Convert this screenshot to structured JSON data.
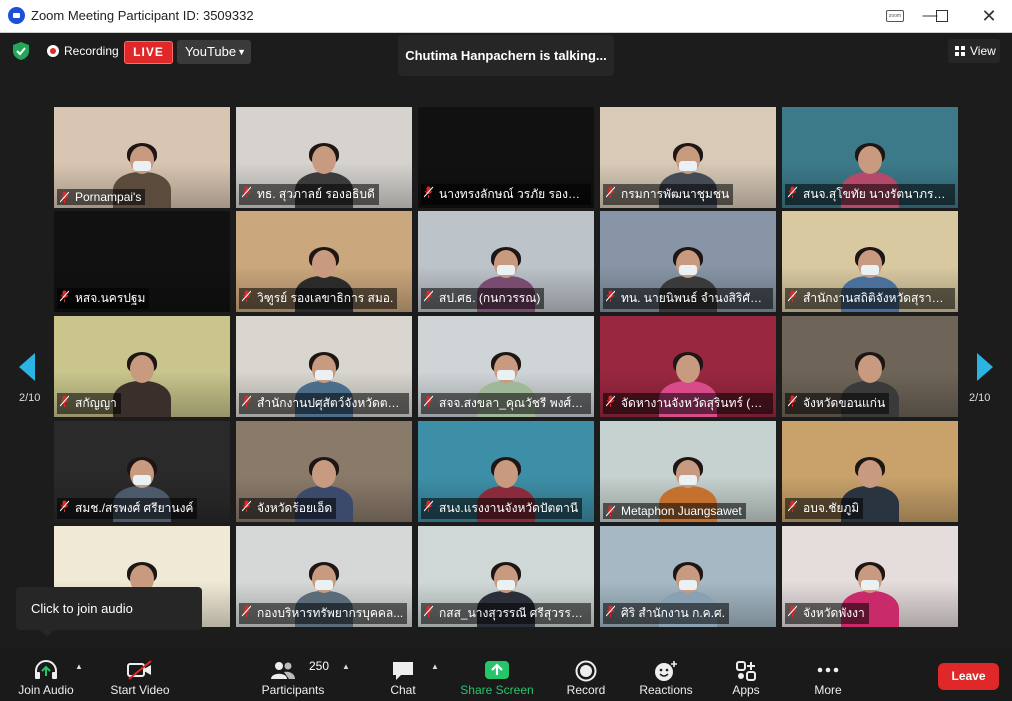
{
  "window": {
    "title": "Zoom Meeting Participant ID: 3509332",
    "controls": [
      "minimize",
      "maximize",
      "close"
    ]
  },
  "topbar": {
    "recording_label": "Recording",
    "live_label": "LIVE",
    "stream_target": "YouTube",
    "talking_banner": "Chutima Hanpachern is talking...",
    "view_label": "View"
  },
  "gallery": {
    "page_indicator": "2/10",
    "tiles": [
      {
        "name": "Pornampai's",
        "bg": "#d9c6b2",
        "body": "#5a4b3c",
        "mask": true
      },
      {
        "name": "ทธ. สุวภาลย์ รองอธิบดี",
        "bg": "#d6d3cf",
        "body": "#3b3b3b",
        "mask": false
      },
      {
        "name": "นางทรงลักษณ์ วรภัย รองผู้ว่า...",
        "bg": "#111111",
        "body": "#111111",
        "mask": false
      },
      {
        "name": "กรมการพัฒนาชุมชน",
        "bg": "#d8cab7",
        "body": "#444b55",
        "mask": true
      },
      {
        "name": "สนจ.สุโขทัย นางรัตนาภรณ์ ...",
        "bg": "#3c7a8a",
        "body": "#b34a6a",
        "mask": false
      },
      {
        "name": "หสจ.นครปฐม",
        "bg": "#111111",
        "body": "#111111",
        "mask": false
      },
      {
        "name": "วิฑูรย์ รองเลขาธิการ สมอ.",
        "bg": "#caa77c",
        "body": "#2a2a2a",
        "mask": false
      },
      {
        "name": "สป.ศธ. (กนกวรรณ)",
        "bg": "#bcc3c9",
        "body": "#7a4b70",
        "mask": true
      },
      {
        "name": "ทน. นายนิพนธ์ จำนงสิริศักดิ์...",
        "bg": "#8795a6",
        "body": "#3a3a3a",
        "mask": true
      },
      {
        "name": "สำนักงานสถิติจังหวัดสุราษฎร์...",
        "bg": "#d8c9a1",
        "body": "#4a6f9a",
        "mask": true
      },
      {
        "name": "สกัญญา",
        "bg": "#c9c58d",
        "body": "#3a2f2a",
        "mask": false
      },
      {
        "name": "สำนักงานปศุสัตว์จังหวัดตราด",
        "bg": "#d9d6cf",
        "body": "#4b6d8c",
        "mask": true
      },
      {
        "name": "สจจ.สงขลา_คุณวัชรี พงศ์นุรั...",
        "bg": "#cfd4d6",
        "body": "#9fb89a",
        "mask": true
      },
      {
        "name": "จัดหางานจังหวัดสุรินทร์ (ขนิ...",
        "bg": "#9a2740",
        "body": "#d84a8a",
        "mask": false
      },
      {
        "name": "จังหวัดขอนแก่น",
        "bg": "#6e6558",
        "body": "#3a3a3a",
        "mask": false
      },
      {
        "name": "สมช./สรพงศ์ ศรียานงค์",
        "bg": "#2a2a2a",
        "body": "#4a5a6a",
        "mask": true
      },
      {
        "name": "จังหวัดร้อยเอ็ด",
        "bg": "#8a7a6a",
        "body": "#3b4a6a",
        "mask": false
      },
      {
        "name": "สนง.แรงงานจังหวัดปัตตานี",
        "bg": "#3d8fa8",
        "body": "#8b2a3a",
        "mask": false
      },
      {
        "name": "Metaphon Juangsawet",
        "bg": "#c6d2cf",
        "body": "#c4712f",
        "mask": true
      },
      {
        "name": "อบจ.ชัยภูมิ",
        "bg": "#c8a26a",
        "body": "#2a3340",
        "mask": false
      },
      {
        "name": "",
        "bg": "#f0e9d6",
        "body": "#9a3a2a",
        "mask": false
      },
      {
        "name": "กองบริหารทรัพยากรบุคคล...",
        "bg": "#d5d8d6",
        "body": "#5a6b7a",
        "mask": true
      },
      {
        "name": "กสส_นางสุวรรณี ศรีสุวรรณ์ ...",
        "bg": "#cfd8d6",
        "body": "#2a2f3a",
        "mask": true
      },
      {
        "name": "ศิริ สำนักงาน ก.ค.ศ.",
        "bg": "#a5b8c4",
        "body": "#8aa1b3",
        "mask": true
      },
      {
        "name": "จังหวัดพังงา",
        "bg": "#e5dcdc",
        "body": "#c92a6a",
        "mask": true
      }
    ]
  },
  "audio_tooltip": "Click to join audio",
  "toolbar": {
    "join_audio": "Join Audio",
    "start_video": "Start Video",
    "participants": "Participants",
    "participant_count": "250",
    "chat": "Chat",
    "share_screen": "Share Screen",
    "record": "Record",
    "reactions": "Reactions",
    "apps": "Apps",
    "more": "More",
    "leave": "Leave"
  },
  "colors": {
    "accent": "#2bb3e3",
    "live": "#e02828",
    "share": "#26c56a",
    "leave": "#e02828"
  }
}
